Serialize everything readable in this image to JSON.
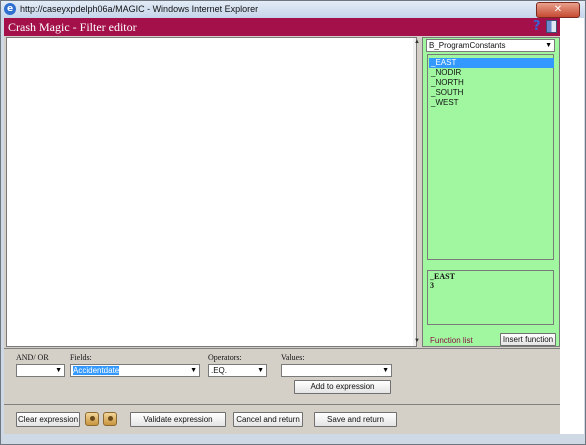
{
  "window": {
    "title": "http://caseyxpdelph06a/MAGIC - Windows Internet Explorer",
    "close_glyph": "✕"
  },
  "app": {
    "title": "Crash Magic - Filter editor",
    "help_glyph": "?"
  },
  "function_panel": {
    "selected_group": "B_ProgramConstants",
    "constants": [
      "_EAST",
      "_NODIR",
      "_NORTH",
      "_SOUTH",
      "_WEST"
    ],
    "selected_constant": "_EAST",
    "description_name": "_EAST",
    "description_value": "3",
    "function_list_label": "Function list",
    "insert_function_label": "Insert function"
  },
  "expression_builder": {
    "and_or_label": "AND/ OR",
    "and_or_value": "",
    "fields_label": "Fields:",
    "fields_value": "Accidentdate",
    "operators_label": "Operators:",
    "operators_value": ".EQ.",
    "values_label": "Values:",
    "values_value": "",
    "add_to_expression_label": "Add to expression"
  },
  "footer": {
    "clear_expression_label": "Clear expression",
    "validate_expression_label": "Validate expression",
    "cancel_and_return_label": "Cancel and return",
    "save_and_return_label": "Save and return"
  },
  "colors": {
    "app_bar": "#a3104a",
    "panel_green": "#a0f7a0",
    "selection_blue": "#3399ff"
  }
}
